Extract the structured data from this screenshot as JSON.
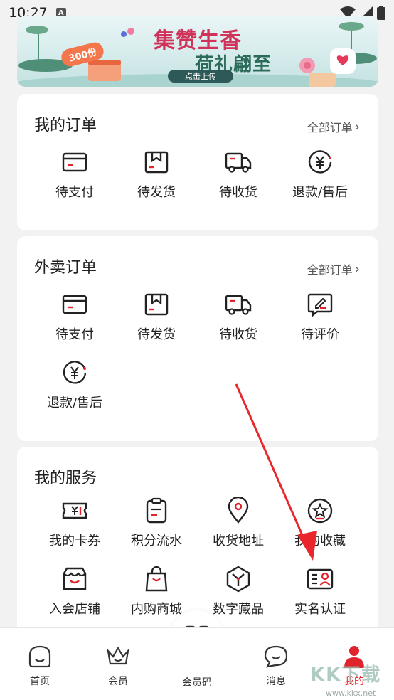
{
  "status_bar": {
    "time": "10:27",
    "notif_letter": "A"
  },
  "banner": {
    "title_line1": "集赞生香",
    "title_line2": "荷礼翩至",
    "badge": "300份",
    "button_label": "点击上传"
  },
  "my_orders": {
    "title": "我的订单",
    "more_label": "全部订单",
    "items": [
      {
        "label": "待支付",
        "icon": "wallet-card-icon"
      },
      {
        "label": "待发货",
        "icon": "package-box-icon"
      },
      {
        "label": "待收货",
        "icon": "delivery-truck-icon"
      },
      {
        "label": "退款/售后",
        "icon": "yen-refund-icon"
      }
    ]
  },
  "takeout_orders": {
    "title": "外卖订单",
    "more_label": "全部订单",
    "items": [
      {
        "label": "待支付",
        "icon": "wallet-card-icon"
      },
      {
        "label": "待发货",
        "icon": "package-box-icon"
      },
      {
        "label": "待收货",
        "icon": "delivery-truck-icon"
      },
      {
        "label": "待评价",
        "icon": "comment-edit-icon"
      },
      {
        "label": "退款/售后",
        "icon": "yen-refund-icon"
      }
    ]
  },
  "my_services": {
    "title": "我的服务",
    "items": [
      {
        "label": "我的卡券",
        "icon": "coupon-icon"
      },
      {
        "label": "积分流水",
        "icon": "points-clipboard-icon"
      },
      {
        "label": "收货地址",
        "icon": "location-pin-icon"
      },
      {
        "label": "我的收藏",
        "icon": "star-favorite-icon"
      },
      {
        "label": "入会店铺",
        "icon": "store-icon"
      },
      {
        "label": "内购商城",
        "icon": "shopping-bag-icon"
      },
      {
        "label": "数字藏品",
        "icon": "digital-collectible-icon"
      },
      {
        "label": "实名认证",
        "icon": "id-card-icon"
      }
    ]
  },
  "tabbar": {
    "items": [
      {
        "label": "首页",
        "icon": "home-face-icon",
        "active": false
      },
      {
        "label": "会员",
        "icon": "crown-icon",
        "active": false
      },
      {
        "label": "会员码",
        "icon": "member-code-grid-icon",
        "active": false
      },
      {
        "label": "消息",
        "icon": "message-bubble-icon",
        "active": false
      },
      {
        "label": "我的",
        "icon": "profile-person-icon",
        "active": true
      }
    ]
  },
  "watermark": {
    "text": "KK下载",
    "url": "www.kkx.net"
  },
  "colors": {
    "accent": "#e0242b",
    "background": "#f2f2f2",
    "card": "#ffffff",
    "arrow": "#e8262b"
  }
}
